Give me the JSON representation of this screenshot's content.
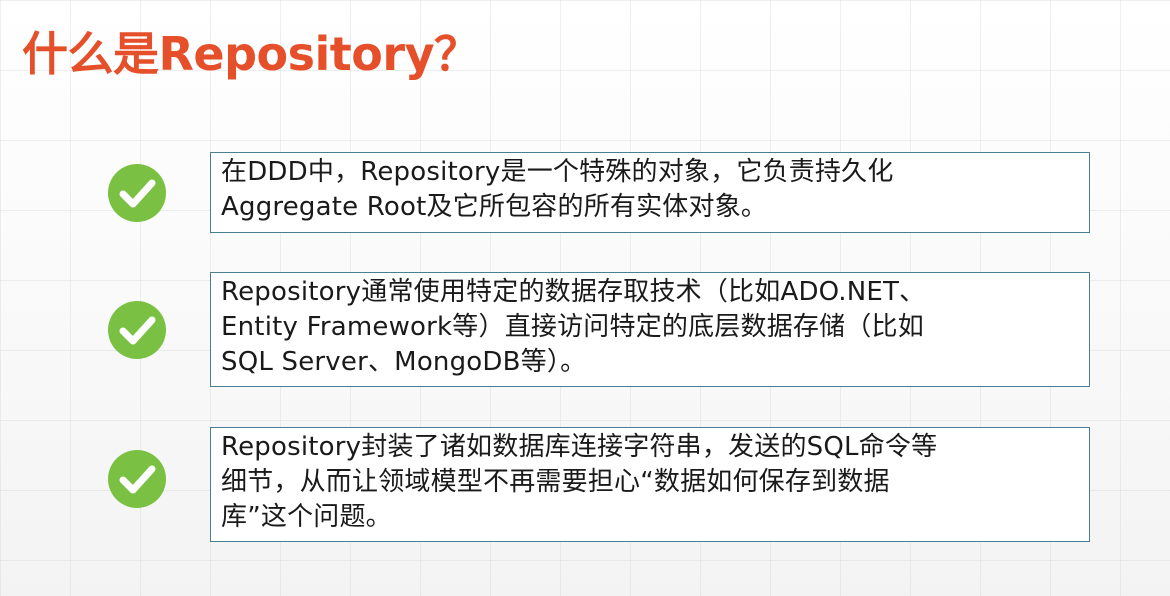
{
  "title": "什么是Repository？",
  "colors": {
    "title": "#e5502b",
    "check_fill": "#7ac143",
    "box_border": "#4a7f93",
    "text": "#1a1a1a"
  },
  "items": [
    {
      "icon": "check-circle-icon",
      "lines": [
        "在DDD中，Repository是一个特殊的对象，它负责持久化",
        "Aggregate Root及它所包容的所有实体对象。"
      ]
    },
    {
      "icon": "check-circle-icon",
      "lines": [
        "Repository通常使用特定的数据存取技术（比如ADO.NET、",
        "Entity Framework等）直接访问特定的底层数据存储（比如",
        "SQL Server、MongoDB等）。"
      ]
    },
    {
      "icon": "check-circle-icon",
      "lines": [
        "Repository封装了诸如数据库连接字符串，发送的SQL命令等",
        "细节，从而让领域模型不再需要担心“数据如何保存到数据",
        "库”这个问题。"
      ]
    }
  ]
}
